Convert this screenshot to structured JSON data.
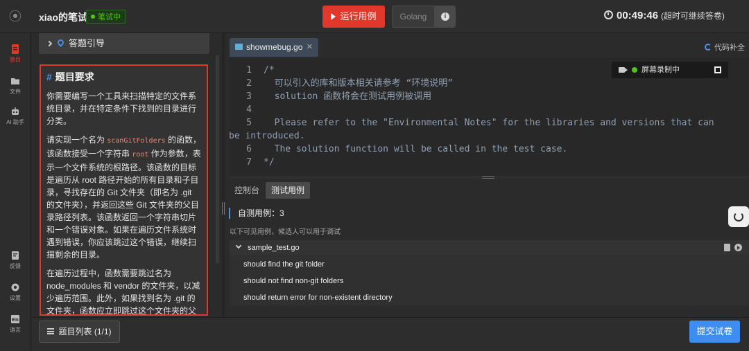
{
  "header": {
    "title": "xiao的笔试",
    "status": "笔试中",
    "run_label": "运行用例",
    "language": "Golang",
    "timer": "00:49:46",
    "timer_note": "(超时可继续答卷)"
  },
  "rail": {
    "items": [
      {
        "label": "题目",
        "icon": "document-icon"
      },
      {
        "label": "文件",
        "icon": "folder-icon"
      },
      {
        "label": "AI 助手",
        "icon": "robot-icon"
      },
      {
        "label": "反馈",
        "icon": "feedback-icon"
      },
      {
        "label": "设置",
        "icon": "gear-icon"
      },
      {
        "label": "语言",
        "icon": "language-icon"
      }
    ]
  },
  "guide": {
    "label": "答题引导"
  },
  "problem": {
    "title": "题目要求",
    "p1": "你需要编写一个工具来扫描特定的文件系统目录，并在特定条件下找到的目录进行分类。",
    "p2_a": "请实现一个名为 ",
    "p2_code1": "scanGitFolders",
    "p2_b": " 的函数，该函数接受一个字符串 ",
    "p2_code2": "root",
    "p2_c": " 作为参数，表示一个文件系统的根路径。该函数的目标是遍历从 root 路径开始的所有目录和子目录，寻找存在的 Git 文件夹（即名为 .git 的文件夹），并返回这些 Git 文件夹的父目录路径列表。该函数返回一个字符串切片和一个错误对象。如果在遍历文件系统时遇到错误，你应该跳过这个错误，继续扫描剩余的目录。",
    "p3": "在遍历过程中，函数需要跳过名为 node_modules 和 vendor 的文件夹，以减少遍历范围。此外，如果找到名为 .git 的文件夹，函数应立即跳过这个文件夹的父目录的其余部分，避免不必要的搜索。"
  },
  "problem_list": {
    "label": "题目列表 (1/1)"
  },
  "editor": {
    "file_tab": "showmebug.go",
    "assist_label": "代码补全",
    "lines": [
      {
        "num": "1",
        "text": "/*"
      },
      {
        "num": "2",
        "text": "  可以引入的库和版本相关请参考 “环境说明”"
      },
      {
        "num": "3",
        "text": "  solution 函数将会在测试用例被调用"
      },
      {
        "num": "4",
        "text": ""
      },
      {
        "num": "5",
        "text": "  Please refer to the \"Environmental Notes\" for the libraries and versions that can"
      },
      {
        "num": "",
        "text": "be introduced."
      },
      {
        "num": "6",
        "text": "  The solution function will be called in the test case."
      },
      {
        "num": "7",
        "text": "*/"
      }
    ]
  },
  "recording": {
    "label": "屏幕录制中"
  },
  "console": {
    "tabs": [
      "控制台",
      "测试用例"
    ],
    "header": "自测用例：3",
    "hint": "以下可见用例，候选人可以用于调试",
    "file": "sample_test.go",
    "cases": [
      "should find the git folder",
      "should not find non-git folders",
      "should return error for non-existent directory"
    ]
  },
  "footer": {
    "submit_label": "提交试卷"
  }
}
